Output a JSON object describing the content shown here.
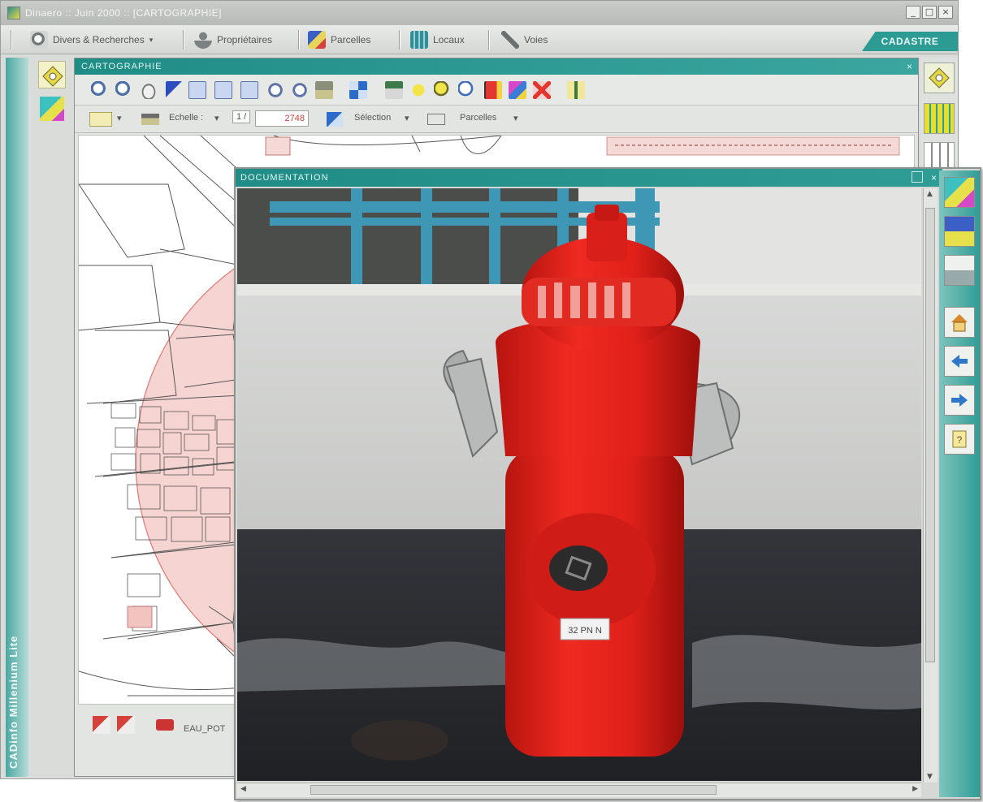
{
  "app": {
    "window_title": "Dinaero :: Juin 2000 :: [CARTOGRAPHIE]",
    "side_label": "CADinfo Millenium Lite"
  },
  "menu": {
    "items": [
      {
        "label": "Divers & Recherches",
        "icon": "search-tools-icon"
      },
      {
        "label": "Propriétaires",
        "icon": "owner-icon"
      },
      {
        "label": "Parcelles",
        "icon": "parcel-icon"
      },
      {
        "label": "Locaux",
        "icon": "building-icon"
      },
      {
        "label": "Voies",
        "icon": "road-icon"
      }
    ],
    "tab": "CADASTRE"
  },
  "carto": {
    "title": "CARTOGRAPHIE",
    "scale_label": "Echelle :",
    "scale_prefix": "1 /",
    "scale_value": "2748",
    "selection_label": "Sélection",
    "layer_dropdown": "Parcelles",
    "bottom_layer": "EAU_POT"
  },
  "doc": {
    "title": "DOCUMENTATION",
    "photo_tag": "32 PN N"
  },
  "colors": {
    "teal": "#2b9b93",
    "hydrant_red": "#e0201a",
    "zone_pink": "#f3c9c6"
  }
}
